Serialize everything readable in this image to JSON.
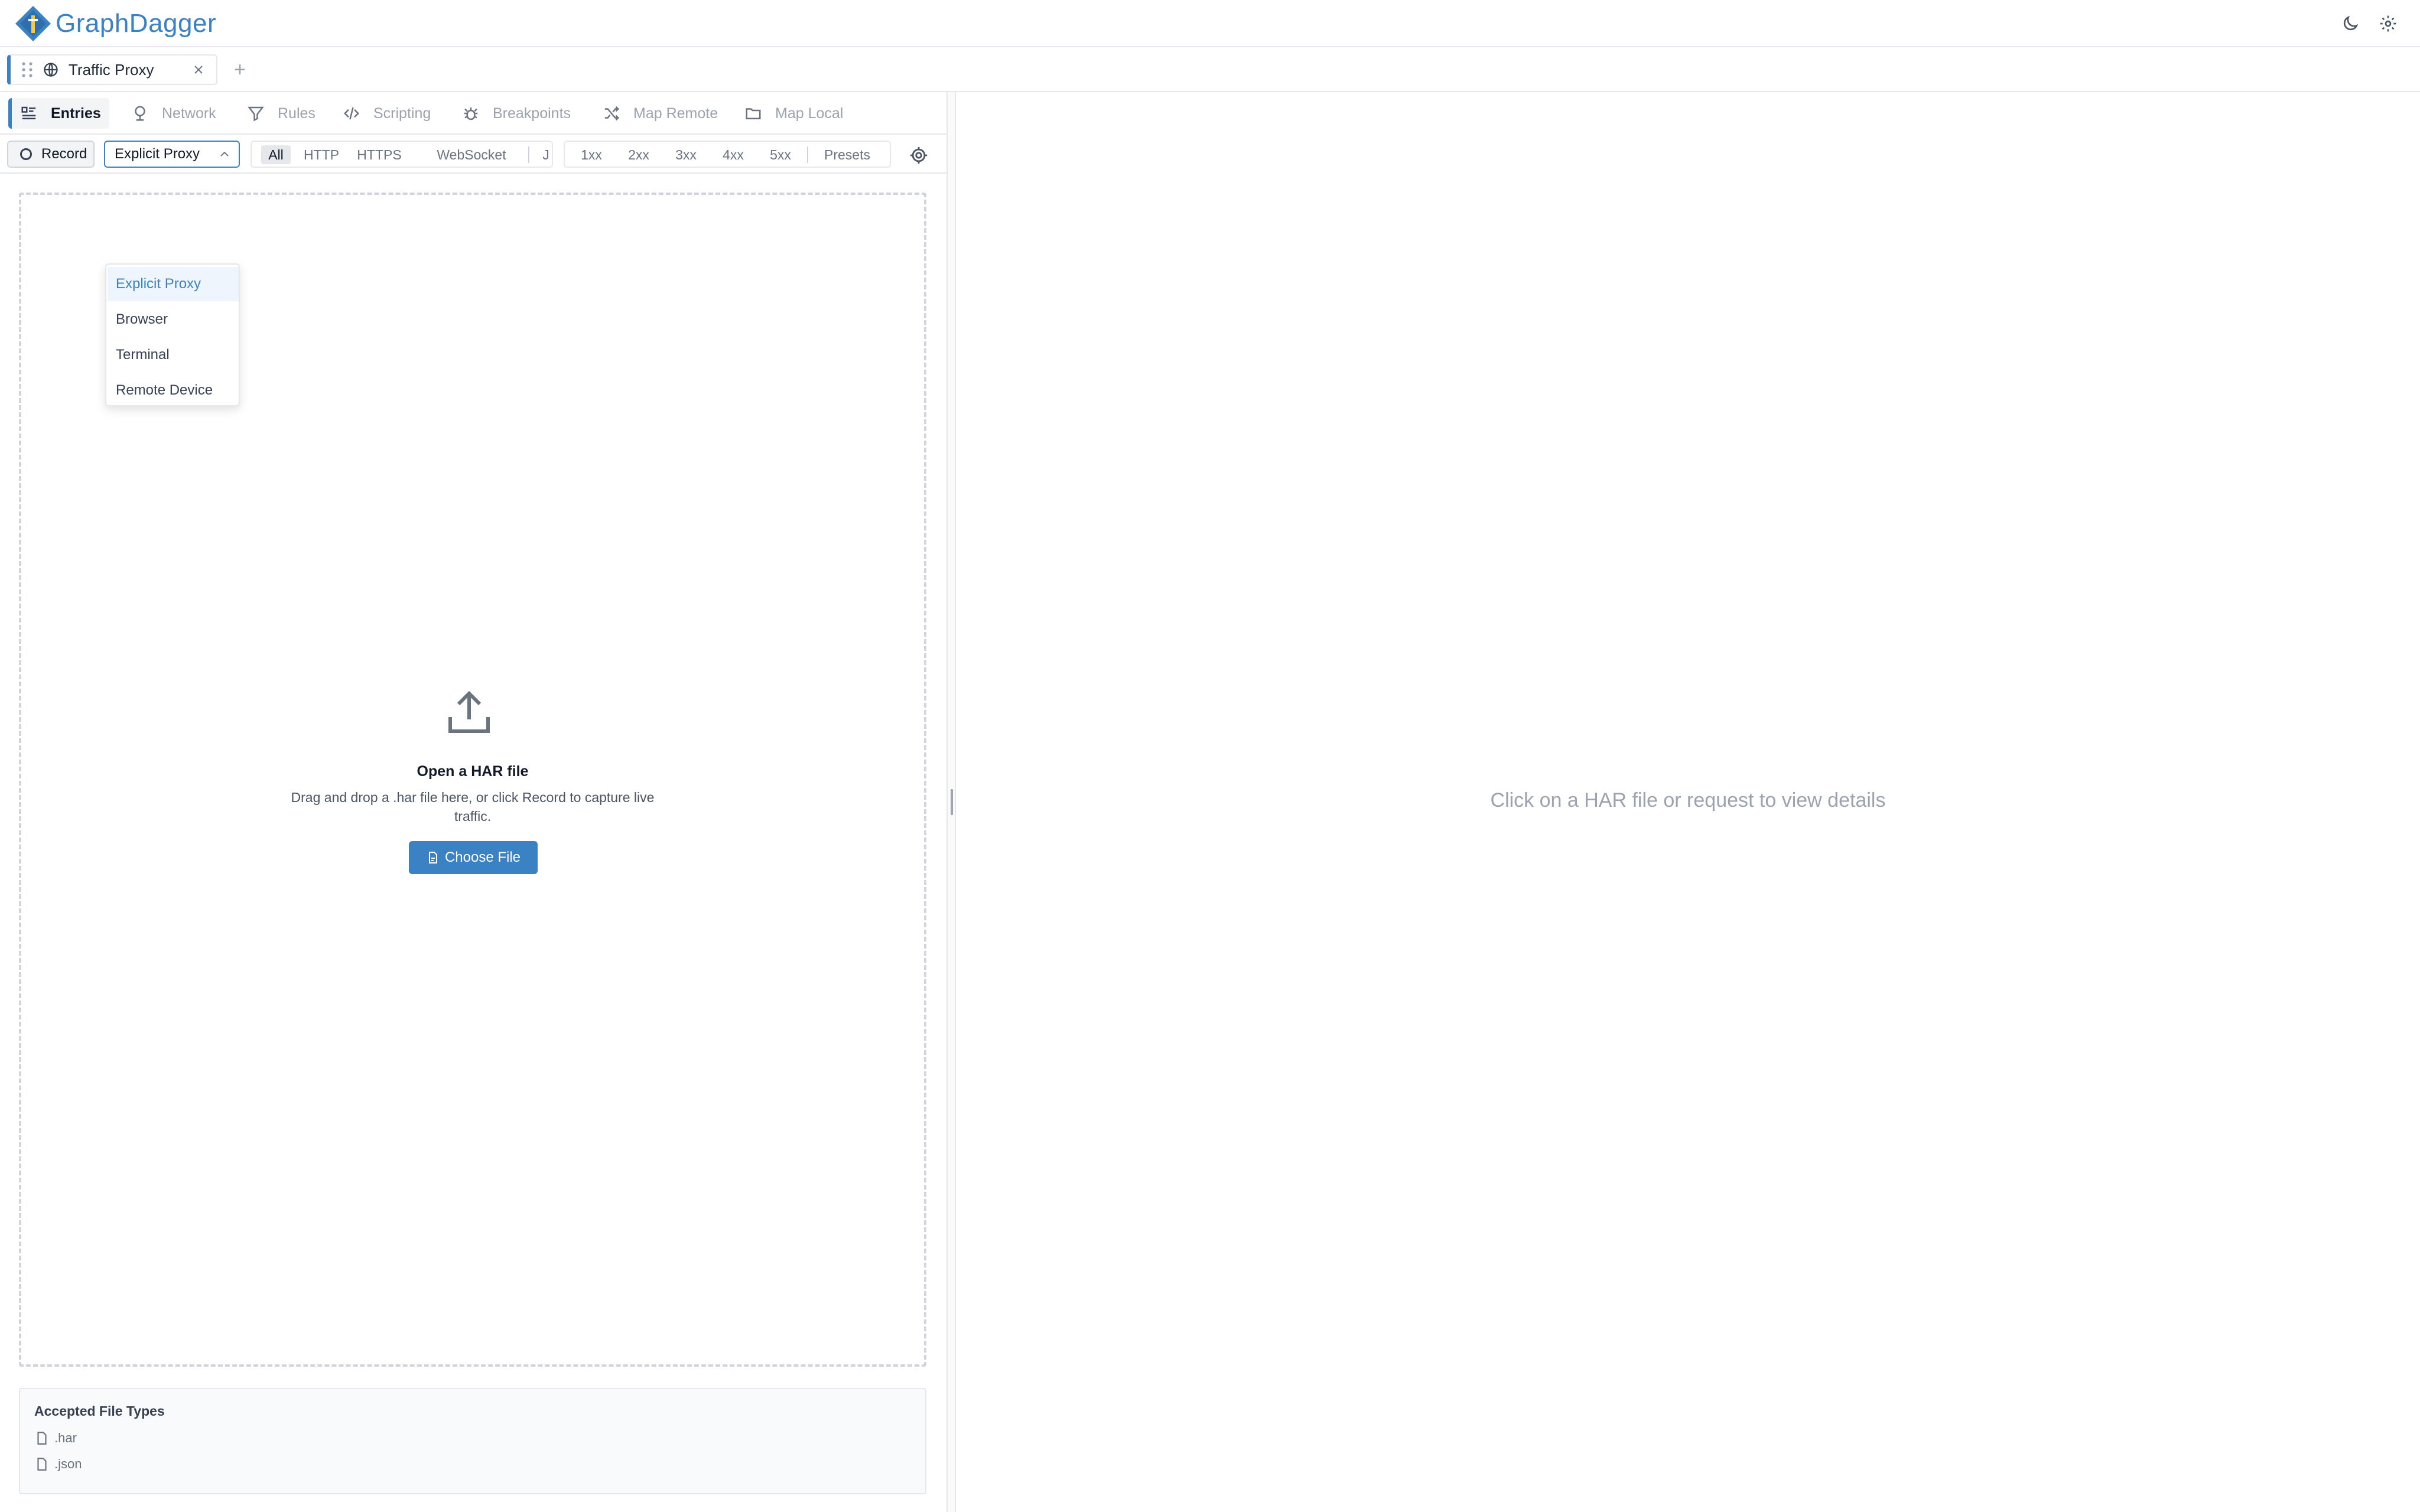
{
  "app": {
    "title": "GraphDagger"
  },
  "tab": {
    "label": "Traffic Proxy",
    "add_label": "+"
  },
  "nav": {
    "items": [
      {
        "label": "Entries",
        "icon": "list-icon"
      },
      {
        "label": "Network",
        "icon": "network-icon"
      },
      {
        "label": "Rules",
        "icon": "filter-icon"
      },
      {
        "label": "Scripting",
        "icon": "code-icon"
      },
      {
        "label": "Breakpoints",
        "icon": "bug-icon"
      },
      {
        "label": "Map Remote",
        "icon": "shuffle-icon"
      },
      {
        "label": "Map Local",
        "icon": "folder-icon"
      }
    ]
  },
  "toolbar": {
    "record_label": "Record",
    "mode_selected": "Explicit Proxy",
    "protocol_filters": [
      "All",
      "HTTP",
      "HTTPS",
      "WebSocket",
      "J"
    ],
    "status_filters": [
      "1xx",
      "2xx",
      "3xx",
      "4xx",
      "5xx",
      "Presets"
    ]
  },
  "dropdown": {
    "options": [
      "Explicit Proxy",
      "Browser",
      "Terminal",
      "Remote Device"
    ]
  },
  "dropzone": {
    "title": "Open a HAR file",
    "description": "Drag and drop a .har file here, or click Record to capture live traffic.",
    "button_label": "Choose File"
  },
  "accepted": {
    "title": "Accepted File Types",
    "types": [
      ".har",
      ".json"
    ]
  },
  "details": {
    "placeholder": "Click on a HAR file or request to view details"
  },
  "colors": {
    "accent": "#3b82c4",
    "border": "#e5e7eb",
    "muted": "#9ca3af"
  }
}
